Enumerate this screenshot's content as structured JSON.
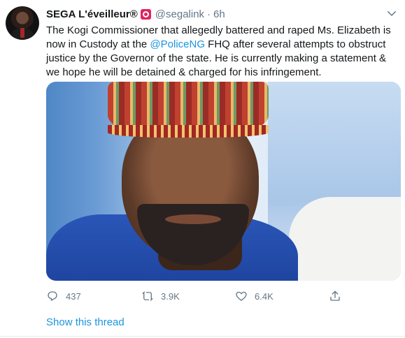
{
  "user": {
    "name": "SEGA L'éveilleur®",
    "handle": "@segalink",
    "separator": "·",
    "time": "6h"
  },
  "tweet": {
    "text_line1": "The Kogi Commissioner that allegedly battered and raped Ms. Elizabeth is",
    "text_line2a": "now in Custody at the ",
    "mention": "@PoliceNG",
    "text_line2b": " FHQ after several attempts to obstruct",
    "text_line3": "justice by the Governor of the state. He is currently making a statement &",
    "text_line4": "we hope he will be detained & charged for his infringement."
  },
  "actions": {
    "replies": "437",
    "retweets": "3.9K",
    "likes": "6.4K"
  },
  "show_thread": "Show this thread",
  "colors": {
    "link": "#1b95e0",
    "secondary": "#657786",
    "text": "#14171a",
    "badge": "#e0245e"
  },
  "icons": {
    "badge": "siren-icon",
    "menu": "chevron-down-icon",
    "reply": "reply-icon",
    "retweet": "retweet-icon",
    "like": "heart-icon",
    "share": "share-icon"
  }
}
